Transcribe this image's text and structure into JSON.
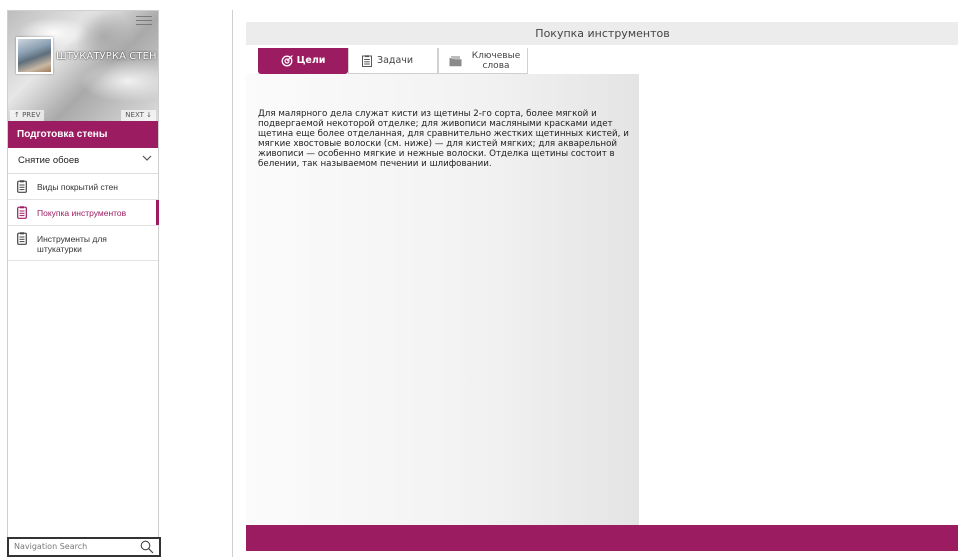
{
  "sidebar": {
    "course_title": "ШТУКАТУРКА СТЕН",
    "prev_label": "↑ PREV",
    "next_label": "NEXT ↓",
    "section_title": "Подготовка стены",
    "group_label": "Снятие обоев",
    "items": [
      {
        "label": "Виды покрытий стен",
        "icon": "document-icon",
        "active": false
      },
      {
        "label": "Покупка инструментов",
        "icon": "document-icon",
        "active": true
      },
      {
        "label": "Инструменты для штукатурки",
        "icon": "document-icon",
        "active": false
      }
    ],
    "search_placeholder": "Navigation Search"
  },
  "main": {
    "page_title": "Покупка инструментов",
    "tabs": [
      {
        "label": "Цели",
        "icon": "target-icon",
        "active": true
      },
      {
        "label": "Задачи",
        "icon": "clipboard-icon",
        "active": false
      },
      {
        "label": "Ключевые слова",
        "icon": "folder-icon",
        "active": false
      }
    ],
    "body_text": "Для малярного дела служат кисти из щетины 2-го сорта, более мягкой и подвергаемой некоторой отделке; для живописи масляными красками идет щетина еще более отделанная, для сравнительно жестких щетинных кистей, и мягкие хвостовые волоски (см. ниже) — для кистей мягких; для акварельной живописи — особенно мягкие и нежные волоски. Отделка щетины состоит в белении, так называемом печении и шлифовании."
  },
  "colors": {
    "accent": "#9c1c61",
    "title_bar": "#ececec",
    "panel": "#f2f2f2"
  }
}
